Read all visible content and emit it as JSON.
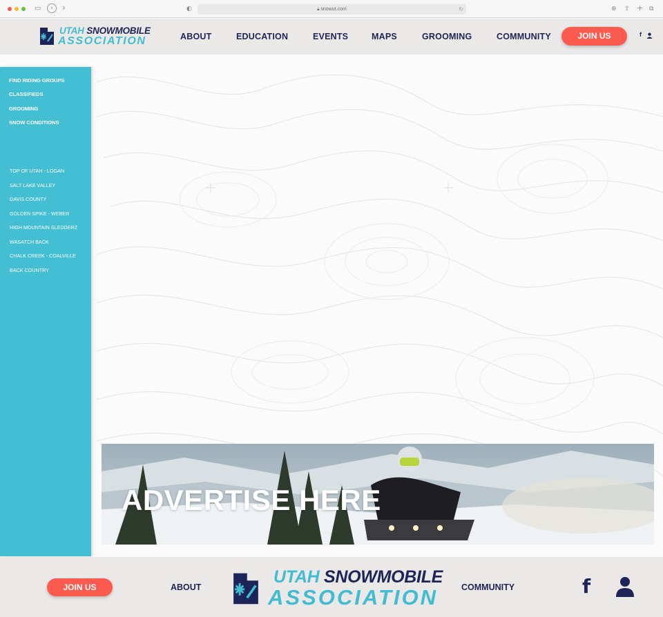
{
  "browser": {
    "url": "snowut.com",
    "back_icon": "chevron-left-icon",
    "forward_icon": "chevron-right-icon"
  },
  "header": {
    "logo_line1_part1": "UTAH ",
    "logo_line1_part2": "SNOWMOBILE",
    "logo_line2": "ASSOCIATION",
    "nav": [
      "ABOUT",
      "EDUCATION",
      "EVENTS",
      "MAPS",
      "GROOMING",
      "COMMUNITY"
    ],
    "join_label": "JOIN US",
    "facebook_glyph": "f"
  },
  "sidebar": {
    "primary": [
      "FIND RIDING GROUPS",
      "CLASSIFIEDS",
      "GROOMING",
      "SNOW CONDITIONS"
    ],
    "regions": [
      "TOP OF UTAH - LOGAN",
      "SALT LAKE VALLEY",
      "DAVIS COUNTY",
      "GOLDEN SPIKE - WEBER",
      "HIGH MOUNTAIN SLEDDERZ",
      "WASATCH BACK",
      "CHALK CREEK - COALVILLE",
      "BACK COUNTRY"
    ]
  },
  "ad": {
    "headline": "ADVERTISE HERE"
  },
  "footer": {
    "join_label": "JOIN US",
    "about_label": "ABOUT",
    "community_label": "COMMUNITY",
    "logo_line1_part1": "UTAH ",
    "logo_line1_part2": "SNOWMOBILE",
    "logo_line2": "ASSOCIATION",
    "facebook_glyph": "f"
  },
  "colors": {
    "brand_navy": "#1d2457",
    "brand_cyan": "#41bcd1",
    "join_red": "#fb5a4f",
    "sidebar_bg": "#44bed2",
    "header_bg": "#ebe9e7"
  }
}
